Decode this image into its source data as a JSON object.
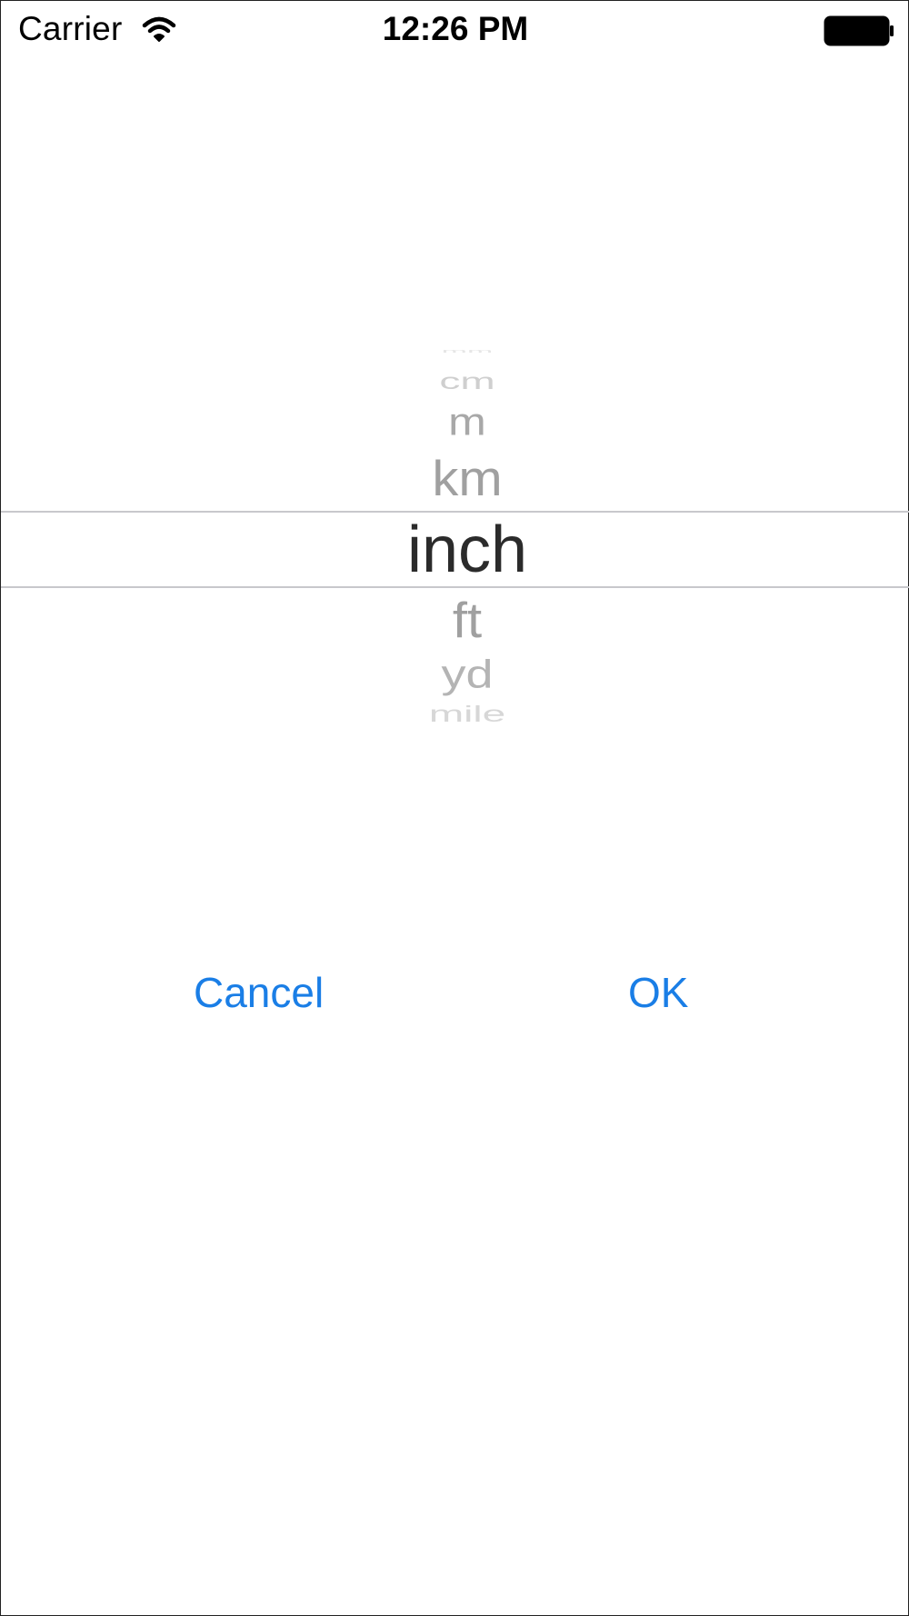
{
  "status_bar": {
    "carrier": "Carrier",
    "time": "12:26 PM",
    "wifi_icon": "wifi-icon",
    "battery_icon": "battery-full-icon"
  },
  "picker": {
    "items": [
      "mm",
      "cm",
      "m",
      "km",
      "inch",
      "ft",
      "yd",
      "mile"
    ],
    "selected": "inch"
  },
  "actions": {
    "cancel_label": "Cancel",
    "ok_label": "OK"
  },
  "colors": {
    "accent": "#1a7ee6",
    "selected_text": "#2b2b2b",
    "unselected_text": "#a0a0a0",
    "selection_line": "#c8c8cc"
  }
}
